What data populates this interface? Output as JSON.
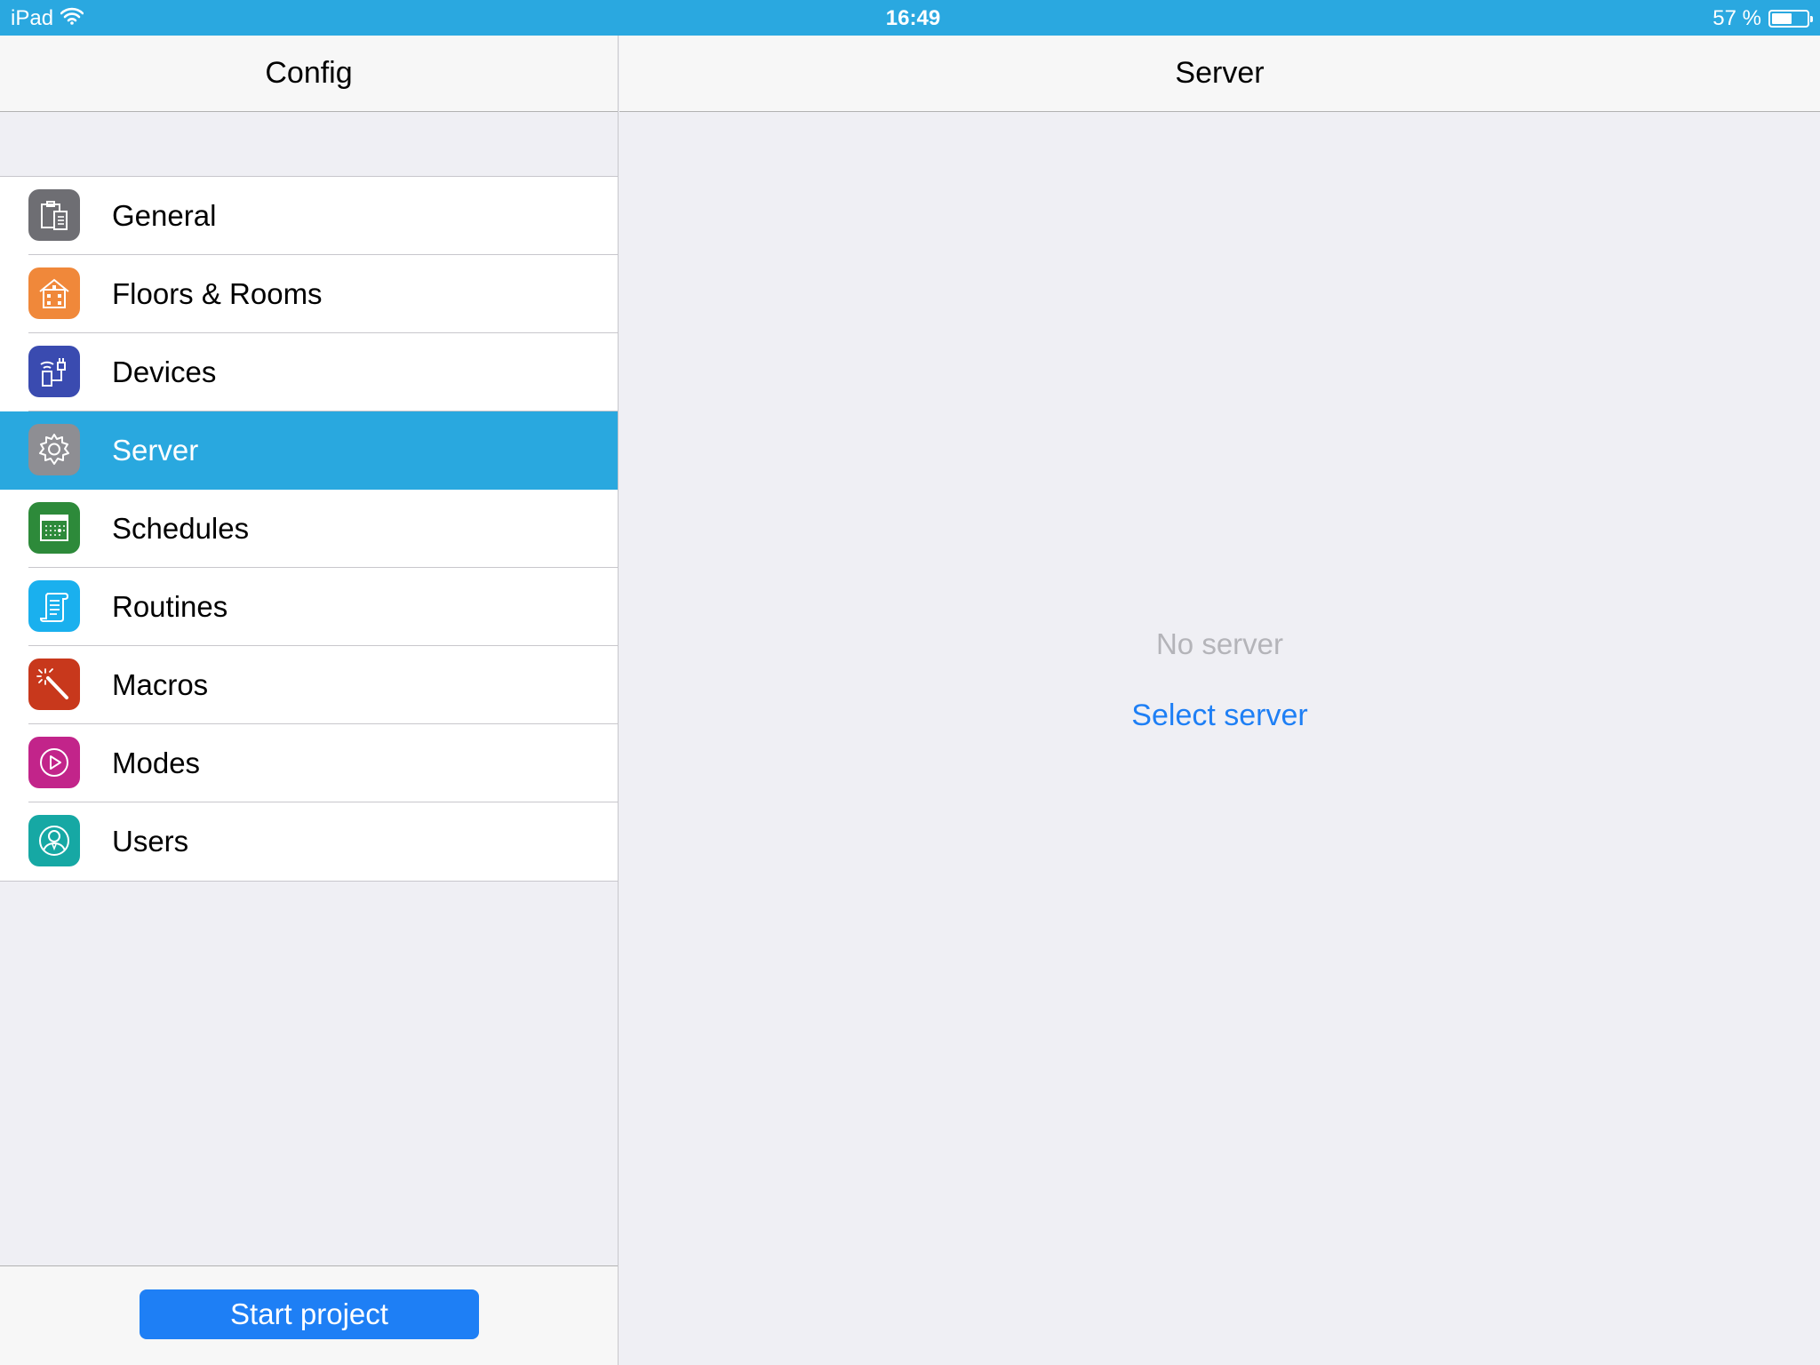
{
  "status_bar": {
    "device": "iPad",
    "time": "16:49",
    "battery_text": "57 %",
    "battery_level": 0.57,
    "wifi_icon": "wifi-icon",
    "background": "#2aa8e0"
  },
  "master": {
    "title": "Config",
    "items": [
      {
        "label": "General",
        "icon": "clipboard-icon",
        "color": "#6e6e73"
      },
      {
        "label": "Floors & Rooms",
        "icon": "house-icon",
        "color": "#f0883a"
      },
      {
        "label": "Devices",
        "icon": "device-plug-icon",
        "color": "#3a4bb0"
      },
      {
        "label": "Server",
        "icon": "gear-icon",
        "color": "#8e8e93",
        "selected": true
      },
      {
        "label": "Schedules",
        "icon": "calendar-icon",
        "color": "#2d8a3a"
      },
      {
        "label": "Routines",
        "icon": "scroll-icon",
        "color": "#1ab0ee"
      },
      {
        "label": "Macros",
        "icon": "magic-wand-icon",
        "color": "#c8381c"
      },
      {
        "label": "Modes",
        "icon": "play-circle-icon",
        "color": "#c2248a"
      },
      {
        "label": "Users",
        "icon": "user-icon",
        "color": "#16a8a4"
      }
    ],
    "start_button": "Start project"
  },
  "detail": {
    "title": "Server",
    "empty_message": "No server",
    "select_link": "Select server"
  },
  "colors": {
    "accent": "#1e7ff5",
    "selection": "#29a8df",
    "background": "#efeff4"
  }
}
